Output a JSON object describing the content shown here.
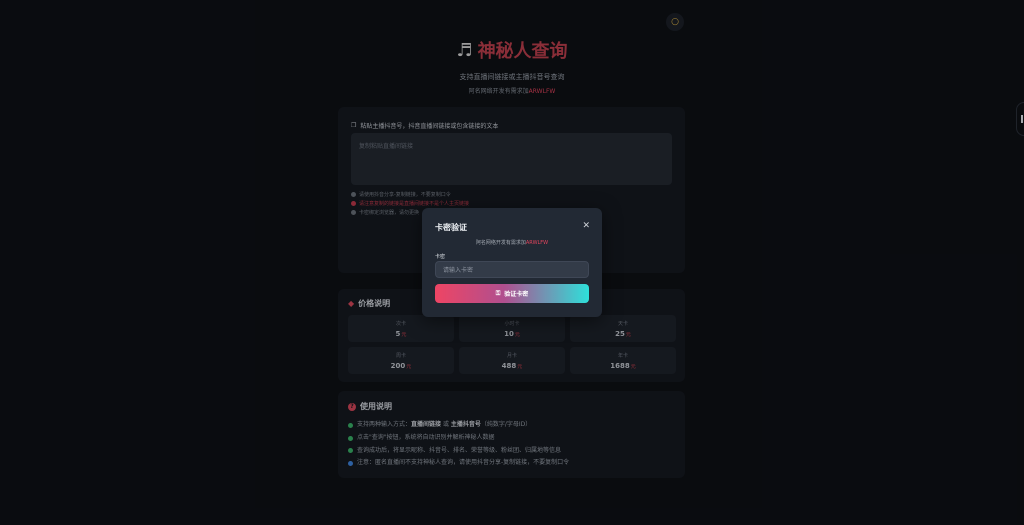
{
  "header": {
    "title": "神秘人查询",
    "subtitle": "支持直播间链接或主播抖音号查询",
    "dev_note_prefix": "阿名网络开发有需求加",
    "dev_note_highlight": "ARWLFW"
  },
  "input_card": {
    "label": "粘贴主播抖音号，抖音直播间链接或包含链接的文本",
    "placeholder": "复制粘贴直播间链接",
    "hints": [
      "请使用抖音分享-复制链接，不要复制口令",
      "请注意复制的链接是直播间链接不是个人主页链接",
      "卡密绑定浏览器，请勿更换"
    ]
  },
  "price": {
    "title": "价格说明",
    "unit": "元",
    "items": [
      {
        "name": "次卡",
        "value": "5"
      },
      {
        "name": "小时卡",
        "value": "10"
      },
      {
        "name": "天卡",
        "value": "25"
      },
      {
        "name": "周卡",
        "value": "200"
      },
      {
        "name": "月卡",
        "value": "488"
      },
      {
        "name": "年卡",
        "value": "1688"
      }
    ]
  },
  "usage": {
    "title": "使用说明",
    "line1": {
      "prefix": "支持两种输入方式：",
      "a": "直播间链接",
      "mid": " 或 ",
      "b": "主播抖音号",
      "suffix": "（纯数字/字母ID）"
    },
    "line2": "点击\"查询\"按钮，系统将自动识别并解析神秘人数据",
    "line3": "查询成功后，将显示昵称、抖音号、排名、荣誉等级、粉丝团、归属地等信息",
    "line4": "注意：匿名直播间不支持神秘人查询，请使用抖音分享-复制链接，不要复制口令"
  },
  "modal": {
    "title": "卡密验证",
    "close": "✕",
    "note_prefix": "阿名网络开发有需求加",
    "note_highlight": "ARWLFW",
    "field_label": "卡密",
    "field_placeholder": "请输入卡密",
    "button_label": "验证卡密"
  },
  "colors": {
    "accent": "#e0445c",
    "background": "#0e1116",
    "card": "#161a21"
  },
  "icons": {
    "title": "music-note-icon",
    "label": "clipboard-icon",
    "price": "tag-icon",
    "usage": "question-icon",
    "button": "key-icon",
    "theme": "sun-icon"
  }
}
